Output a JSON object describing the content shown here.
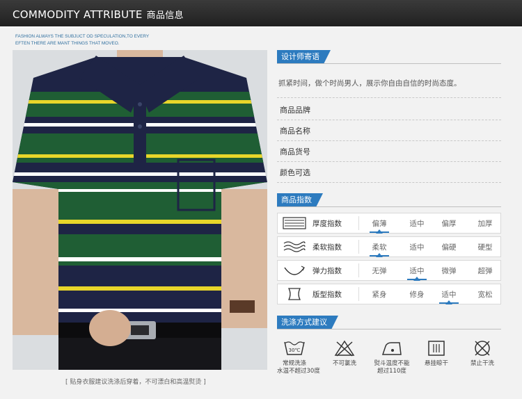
{
  "header": {
    "title": "COMMODITY ATTRIBUTE",
    "title_cn": "商品信息",
    "tagline_1": "FASHION ALWAYS THE  SUBJUCT OD SPECULATION,TO EVERY",
    "tagline_2": "EFTEN THERE ARE MANT THINGS THAT MOVEO."
  },
  "photo": {
    "caption": "[  贴身衣服建议洗涤后穿着，不可漂白和高温熨烫  ]",
    "colors": {
      "navy": "#1e2445",
      "green": "#1f5e34",
      "yellow": "#e8d62a",
      "white": "#ffffff"
    }
  },
  "designer": {
    "tab": "设计师寄语",
    "text": "抓紧时间，做个时尚男人，展示你自由自信的时尚态度。"
  },
  "attributes": [
    {
      "label": "商品品牌"
    },
    {
      "label": "商品名称"
    },
    {
      "label": "商品货号"
    },
    {
      "label": "颜色可选"
    }
  ],
  "index": {
    "tab": "商品指数",
    "rows": [
      {
        "icon": "thickness-icon",
        "label": "厚度指数",
        "options": [
          "偏薄",
          "适中",
          "偏厚",
          "加厚"
        ],
        "selected": 0
      },
      {
        "icon": "softness-icon",
        "label": "柔软指数",
        "options": [
          "柔软",
          "适中",
          "偏硬",
          "硬型"
        ],
        "selected": 0
      },
      {
        "icon": "elasticity-icon",
        "label": "弹力指数",
        "options": [
          "无弹",
          "适中",
          "微弹",
          "超弹"
        ],
        "selected": 1
      },
      {
        "icon": "fit-icon",
        "label": "版型指数",
        "options": [
          "紧身",
          "修身",
          "适中",
          "宽松"
        ],
        "selected": 2
      }
    ]
  },
  "wash": {
    "tab": "洗涤方式建议",
    "items": [
      {
        "icon": "wash-30-icon",
        "symbol": "30℃",
        "line1": "常规洗涤",
        "line2": "水温不超过30度"
      },
      {
        "icon": "no-bleach-icon",
        "line1": "不可氯洗",
        "line2": ""
      },
      {
        "icon": "iron-icon",
        "line1": "熨斗温度不能",
        "line2": "超过110度"
      },
      {
        "icon": "hang-dry-icon",
        "line1": "悬挂晾干",
        "line2": ""
      },
      {
        "icon": "no-dryclean-icon",
        "line1": "禁止干洗",
        "line2": ""
      }
    ]
  },
  "accent": "#2d7bbf"
}
